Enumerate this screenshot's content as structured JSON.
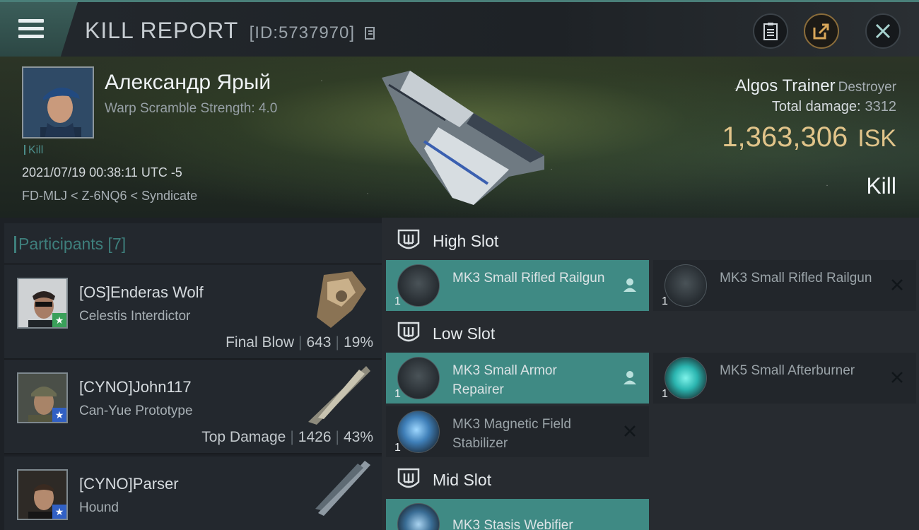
{
  "header": {
    "title": "KILL REPORT",
    "report_id": "[ID:5737970]"
  },
  "victim": {
    "name": "Александр Ярый",
    "warp_scramble": "Warp Scramble Strength: 4.0",
    "kill_tag": "Kill",
    "timestamp": "2021/07/19 00:38:11 UTC -5",
    "location": "FD-MLJ < Z-6NQ6 < Syndicate",
    "ship": "Algos Trainer",
    "ship_class": "Destroyer",
    "total_damage_label": "Total damage:",
    "total_damage": "3312",
    "isk_value": "1,363,306",
    "isk_unit": "ISK",
    "result": "Kill"
  },
  "participants": {
    "header": "Participants [7]",
    "rows": [
      {
        "name": "[OS]Enderas Wolf",
        "ship": "Celestis Interdictor",
        "stat_label": "Final Blow",
        "damage": "643",
        "percent": "19%",
        "badge": "green"
      },
      {
        "name": "[CYNO]John117",
        "ship": "Can-Yue Prototype",
        "stat_label": "Top Damage",
        "damage": "1426",
        "percent": "43%",
        "badge": "blue"
      },
      {
        "name": "[CYNO]Parser",
        "ship": "Hound",
        "stat_label": "",
        "damage": "",
        "percent": "",
        "badge": "blue"
      }
    ]
  },
  "slots": {
    "high": {
      "label": "High Slot",
      "modules": [
        {
          "name": "MK3 Small Rifled Railgun",
          "qty": "1",
          "status": "dropped"
        },
        {
          "name": "MK3 Small Rifled Railgun",
          "qty": "1",
          "status": "destroyed"
        }
      ]
    },
    "low": {
      "label": "Low Slot",
      "modules": [
        {
          "name": "MK3 Small Armor Repairer",
          "qty": "1",
          "status": "dropped"
        },
        {
          "name": "MK5 Small Afterburner",
          "qty": "1",
          "status": "destroyed"
        },
        {
          "name": "MK3 Magnetic Field Stabilizer",
          "qty": "1",
          "status": "destroyed"
        }
      ]
    },
    "mid": {
      "label": "Mid Slot",
      "modules": [
        {
          "name": "MK3 Stasis Webifier",
          "qty": "1",
          "status": "dropped"
        }
      ]
    }
  },
  "icons": [
    "menu-icon",
    "clipboard-icon",
    "share-icon",
    "close-icon",
    "copy-icon",
    "shield-icon",
    "person-icon",
    "x-icon",
    "star-icon"
  ],
  "colors": {
    "accent_teal": "#3f8a84",
    "isk_gold": "#e1c48a",
    "final_blow_badge": "#3aa05a",
    "top_damage_badge": "#3160c4"
  }
}
